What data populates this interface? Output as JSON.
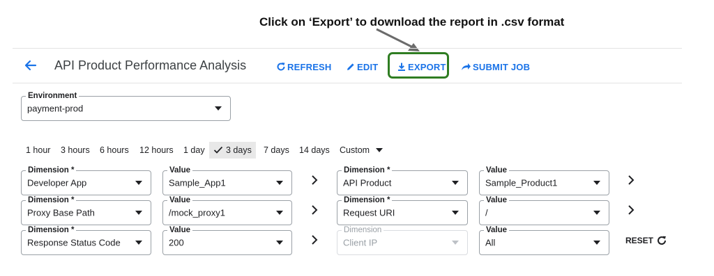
{
  "annotation": {
    "text": "Click on ‘Export’ to download the report in .csv format"
  },
  "header": {
    "title": "API Product Performance Analysis",
    "actions": {
      "refresh": "REFRESH",
      "edit": "EDIT",
      "export": "EXPORT",
      "submit_job": "SUBMIT JOB"
    }
  },
  "environment": {
    "label": "Environment",
    "value": "payment-prod"
  },
  "time_ranges": {
    "options": [
      "1 hour",
      "3 hours",
      "6 hours",
      "12 hours",
      "1 day",
      "3 days",
      "7 days",
      "14 days",
      "Custom"
    ],
    "selected": "3 days"
  },
  "filters": {
    "rows": [
      {
        "left": {
          "dim_label": "Dimension *",
          "dim_value": "Developer App",
          "val_label": "Value",
          "val_value": "Sample_App1"
        },
        "right": {
          "dim_label": "Dimension *",
          "dim_value": "API Product",
          "val_label": "Value",
          "val_value": "Sample_Product1"
        }
      },
      {
        "left": {
          "dim_label": "Dimension *",
          "dim_value": "Proxy Base Path",
          "val_label": "Value",
          "val_value": "/mock_proxy1"
        },
        "right": {
          "dim_label": "Dimension *",
          "dim_value": "Request URI",
          "val_label": "Value",
          "val_value": "/"
        }
      },
      {
        "left": {
          "dim_label": "Dimension *",
          "dim_value": "Response Status Code",
          "val_label": "Value",
          "val_value": "200"
        },
        "right": {
          "dim_label": "Dimension",
          "dim_value": "Client IP",
          "val_label": "Value",
          "val_value": "All"
        }
      }
    ],
    "reset_label": "RESET"
  },
  "colors": {
    "accent": "#1a73e8",
    "highlight": "#2f7d22"
  },
  "icons": [
    "back-arrow-icon",
    "refresh-icon",
    "edit-icon",
    "download-icon",
    "submit-icon",
    "check-icon",
    "chevron-right-icon",
    "reset-icon"
  ]
}
